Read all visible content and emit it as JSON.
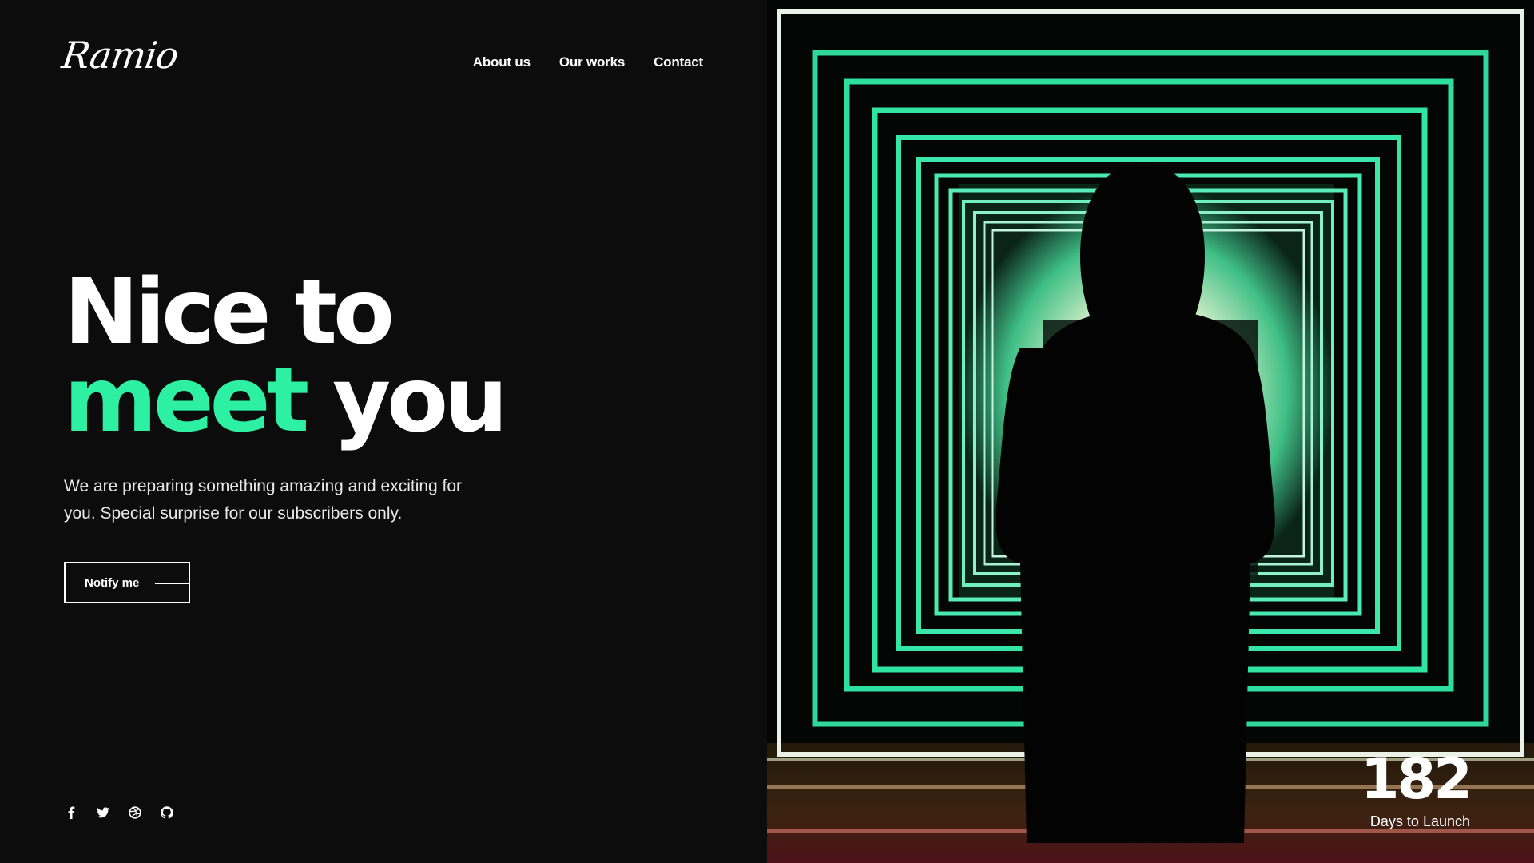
{
  "brand": {
    "logo_text": "Ramio"
  },
  "nav": {
    "items": [
      "About us",
      "Our works",
      "Contact"
    ]
  },
  "hero": {
    "line1": "Nice to",
    "line2_accent": "meet",
    "line2_rest": "you",
    "accent_color": "#2ef0a2"
  },
  "lead": "We are preparing something amazing and exciting for you. Special surprise for our subscribers only.",
  "cta": {
    "label": "Notify me"
  },
  "social": {
    "icons": [
      "facebook-icon",
      "twitter-icon",
      "dribbble-icon",
      "github-icon"
    ]
  },
  "countdown": {
    "value": "182",
    "label": "Days to Launch"
  },
  "colors": {
    "background": "#0c0c0c",
    "accent": "#2ef0a2",
    "text": "#ffffff"
  }
}
